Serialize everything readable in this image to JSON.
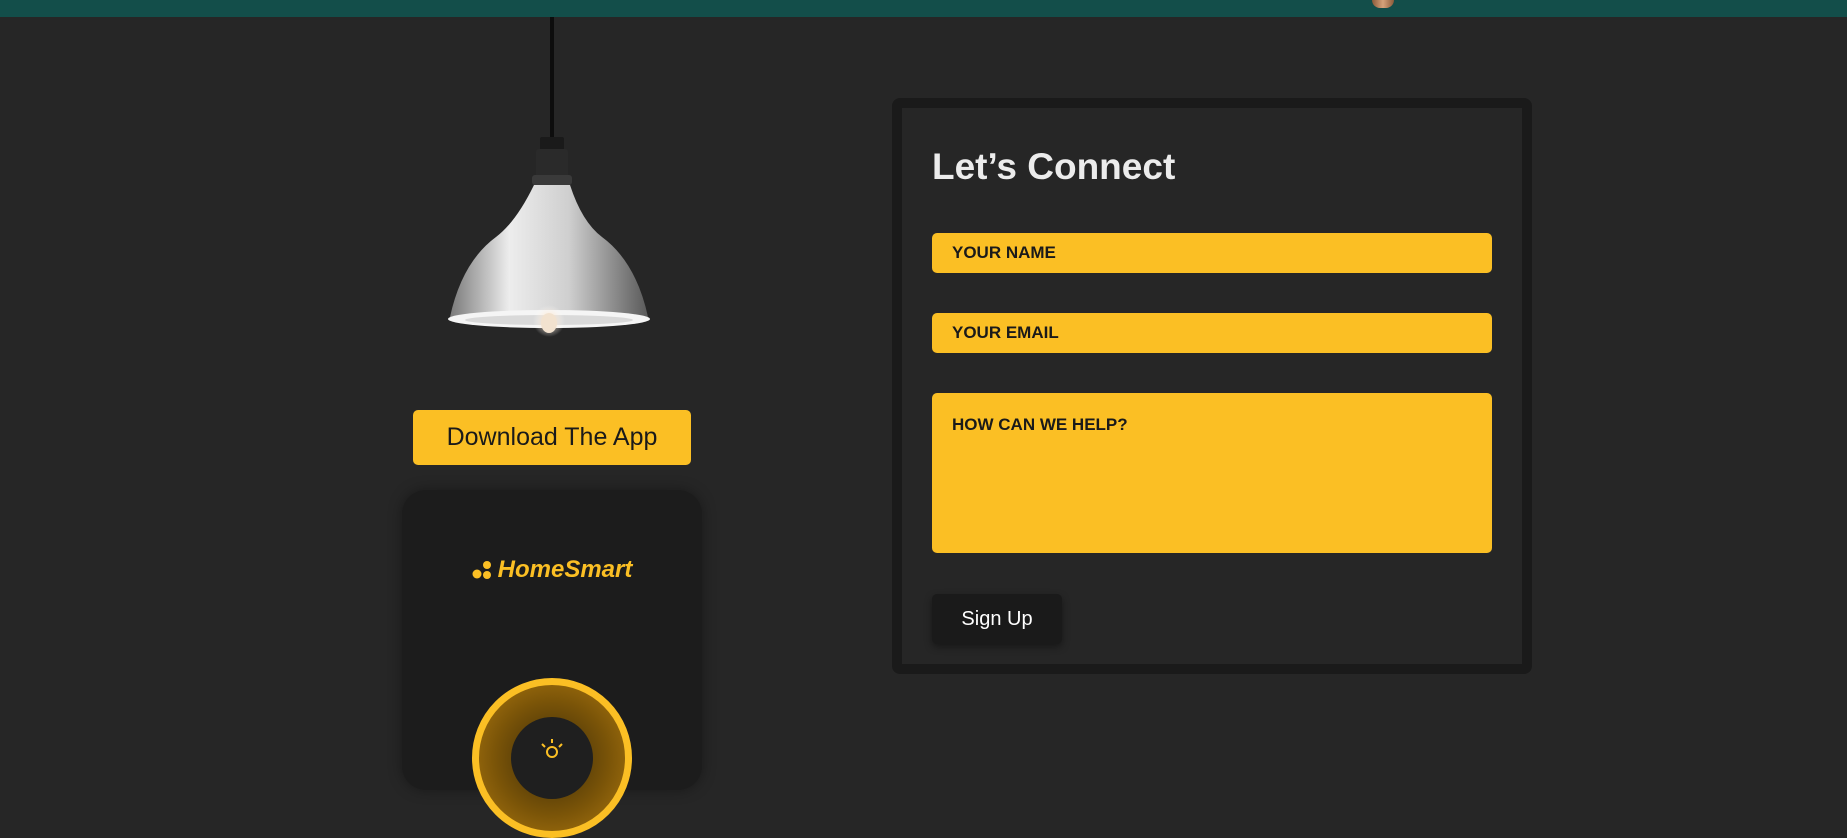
{
  "header": {
    "bar_color": "#134e4a"
  },
  "hero": {
    "image": "pendant-lamp",
    "download_label": "Download The App"
  },
  "app_preview": {
    "brand_name": "HomeSmart",
    "brand_icon": "dots-logo-icon",
    "dial_icon": "sun-icon"
  },
  "contact": {
    "title": "Let’s Connect",
    "name_placeholder": "YOUR NAME",
    "email_placeholder": "YOUR EMAIL",
    "help_placeholder": "HOW CAN WE HELP?",
    "submit_label": "Sign Up"
  },
  "colors": {
    "accent": "#fbbf24",
    "background": "#262626",
    "card_border": "#1a1a1a",
    "button_dark": "#1a1a1a"
  }
}
